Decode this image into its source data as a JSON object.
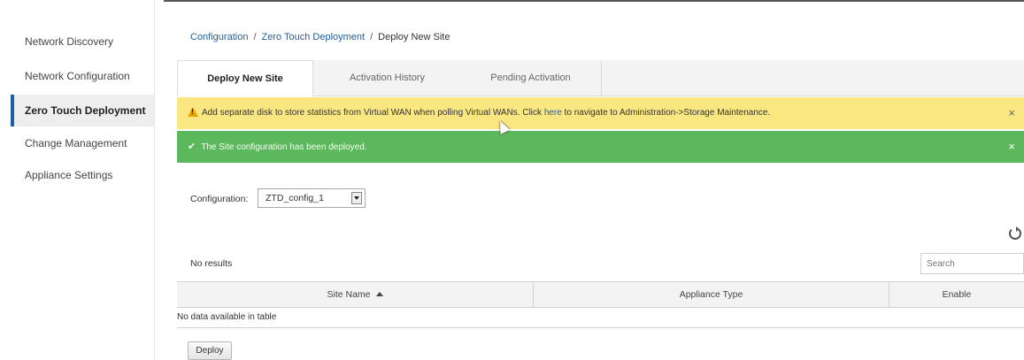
{
  "sidebar": {
    "items": [
      {
        "label": "Network Discovery"
      },
      {
        "label": "Network Configuration"
      },
      {
        "label": "Zero Touch Deployment",
        "active": true
      },
      {
        "label": "Change Management"
      },
      {
        "label": "Appliance Settings"
      }
    ]
  },
  "breadcrumb": {
    "items": [
      "Configuration",
      "Zero Touch Deployment",
      "Deploy New Site"
    ],
    "separator": "/"
  },
  "tabs": [
    {
      "label": "Deploy New Site",
      "active": true
    },
    {
      "label": "Activation History"
    },
    {
      "label": "Pending Activation"
    }
  ],
  "alerts": {
    "warning": {
      "icon": "warning-icon",
      "text_before": "Add separate disk to store statistics from Virtual WAN when polling Virtual WANs. Click ",
      "link": "here",
      "text_after": " to navigate to Administration->Storage Maintenance.",
      "close": "×",
      "color": "#fbe781"
    },
    "success": {
      "icon": "check-icon",
      "icon_glyph": "✔",
      "text": "The Site configuration has been deployed.",
      "close": "×",
      "color": "#5cb85c"
    }
  },
  "configuration": {
    "label": "Configuration:",
    "selected": "ZTD_config_1"
  },
  "table": {
    "status": "No results",
    "search_placeholder": "Search",
    "columns": [
      {
        "label": "Site Name",
        "sorted": "ascending"
      },
      {
        "label": "Appliance Type"
      },
      {
        "label": "Enable"
      }
    ],
    "empty_message": "No data available in table"
  },
  "actions": {
    "deploy_label": "Deploy"
  },
  "colors": {
    "accent": "#1f5fa0",
    "warning_bg": "#fbe781",
    "success_bg": "#5cb85c"
  }
}
